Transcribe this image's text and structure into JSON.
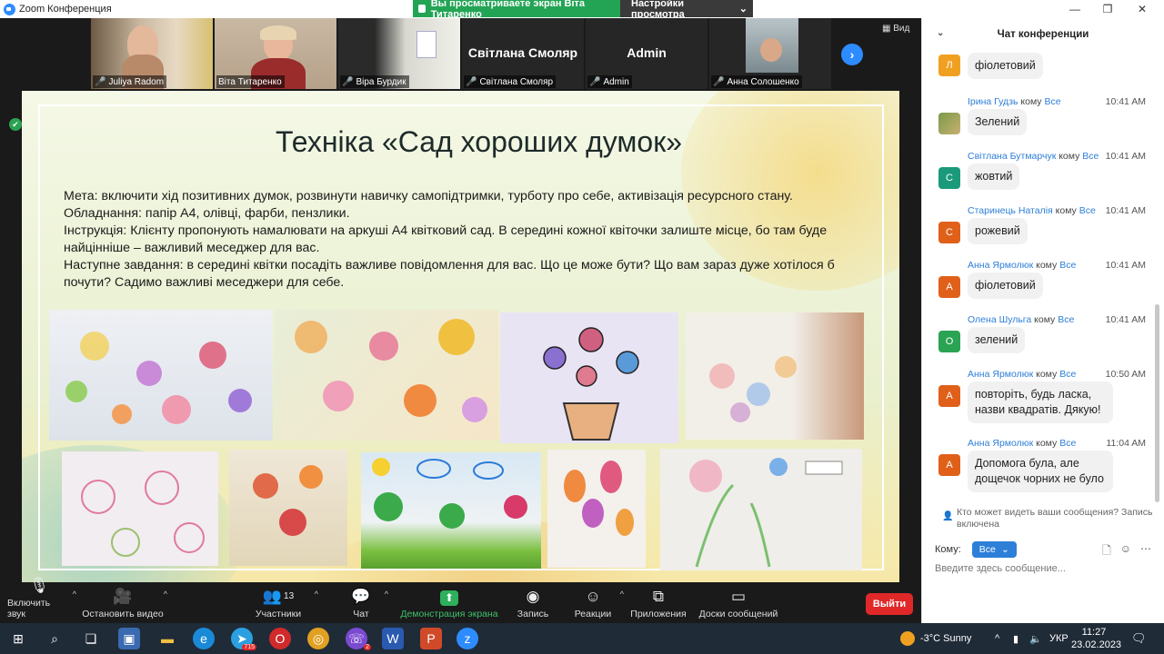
{
  "window": {
    "title": "Zoom Конференция",
    "share_banner": "Вы просматриваете экран Віта Титаренко",
    "view_settings": "Настройки просмотра"
  },
  "gallery": {
    "view_label": "Вид",
    "tiles": [
      {
        "label": "Juliya Radom",
        "big_name": ""
      },
      {
        "label": "Віта Титаренко",
        "big_name": ""
      },
      {
        "label": "Віра Бурдик",
        "big_name": ""
      },
      {
        "label": "Світлана Смоляр",
        "big_name": "Світлана Смоляр"
      },
      {
        "label": "Admin",
        "big_name": "Admin"
      },
      {
        "label": "Анна Солошенко",
        "big_name": ""
      }
    ]
  },
  "slide": {
    "title": "Техніка «Сад хороших думок»",
    "lines": [
      "Мета: включити хід позитивних думок, розвинути навичку самопідтримки, турботу про себе, активізація ресурсного стану.",
      "Обладнання: папір А4, олівці, фарби, пензлики.",
      "Інструкція: Клієнту пропонують намалювати на аркуші А4 квітковий сад. В середині кожної квіточки залиште місце, бо там буде найцінніше – важливий меседжер для вас.",
      "Наступне завдання: в середині квітки посадіть важливе повідомлення для вас. Що це може бути? Що вам зараз дуже хотілося б почути? Садимо важливі меседжери для себе."
    ]
  },
  "toolbar": {
    "mute": "Включить звук",
    "video": "Остановить видео",
    "participants": "Участники",
    "participants_count": "13",
    "chat": "Чат",
    "share": "Демонстрация экрана",
    "record": "Запись",
    "reactions": "Реакции",
    "apps": "Приложения",
    "whiteboards": "Доски сообщений",
    "leave": "Выйти"
  },
  "chat": {
    "title": "Чат конференции",
    "to_word": "кому",
    "messages": [
      {
        "sender": "",
        "to": "",
        "time": "",
        "initial": "Л",
        "color": "#f0a020",
        "text": "фіолетовий"
      },
      {
        "sender": "Ірина Гудзь",
        "to": "Все",
        "time": "10:41 AM",
        "initial": "",
        "color": "#6a8a4a",
        "text": "Зелений"
      },
      {
        "sender": "Світлана Бутмарчук",
        "to": "Все",
        "time": "10:41 AM",
        "initial": "С",
        "color": "#1a9a7a",
        "text": "жовтий"
      },
      {
        "sender": "Старинець Наталія",
        "to": "Все",
        "time": "10:41 AM",
        "initial": "С",
        "color": "#e0601a",
        "text": "рожевий"
      },
      {
        "sender": "Анна Ярмолюк",
        "to": "Все",
        "time": "10:41 AM",
        "initial": "А",
        "color": "#e0601a",
        "text": "фіолетовий"
      },
      {
        "sender": "Олена Шульга",
        "to": "Все",
        "time": "10:41 AM",
        "initial": "О",
        "color": "#2aa352",
        "text": "зелений"
      },
      {
        "sender": "Анна Ярмолюк",
        "to": "Все",
        "time": "10:50 AM",
        "initial": "А",
        "color": "#e0601a",
        "text": "повторіть, будь ласка, назви квадратів. Дякую!"
      },
      {
        "sender": "Анна Ярмолюк",
        "to": "Все",
        "time": "11:04 AM",
        "initial": "А",
        "color": "#e0601a",
        "text": "Допомога була, але дощечок чорних не було"
      }
    ],
    "who_can_see": "Кто может видеть ваши сообщения? Запись включена",
    "to_label": "Кому:",
    "to_value": "Все",
    "input_placeholder": "Введите здесь сообщение..."
  },
  "taskbar": {
    "weather": "-3°C  Sunny",
    "lang": "УКР",
    "time": "11:27",
    "date": "23.02.2023",
    "telegram_badge": "715",
    "viber_badge": "2"
  }
}
